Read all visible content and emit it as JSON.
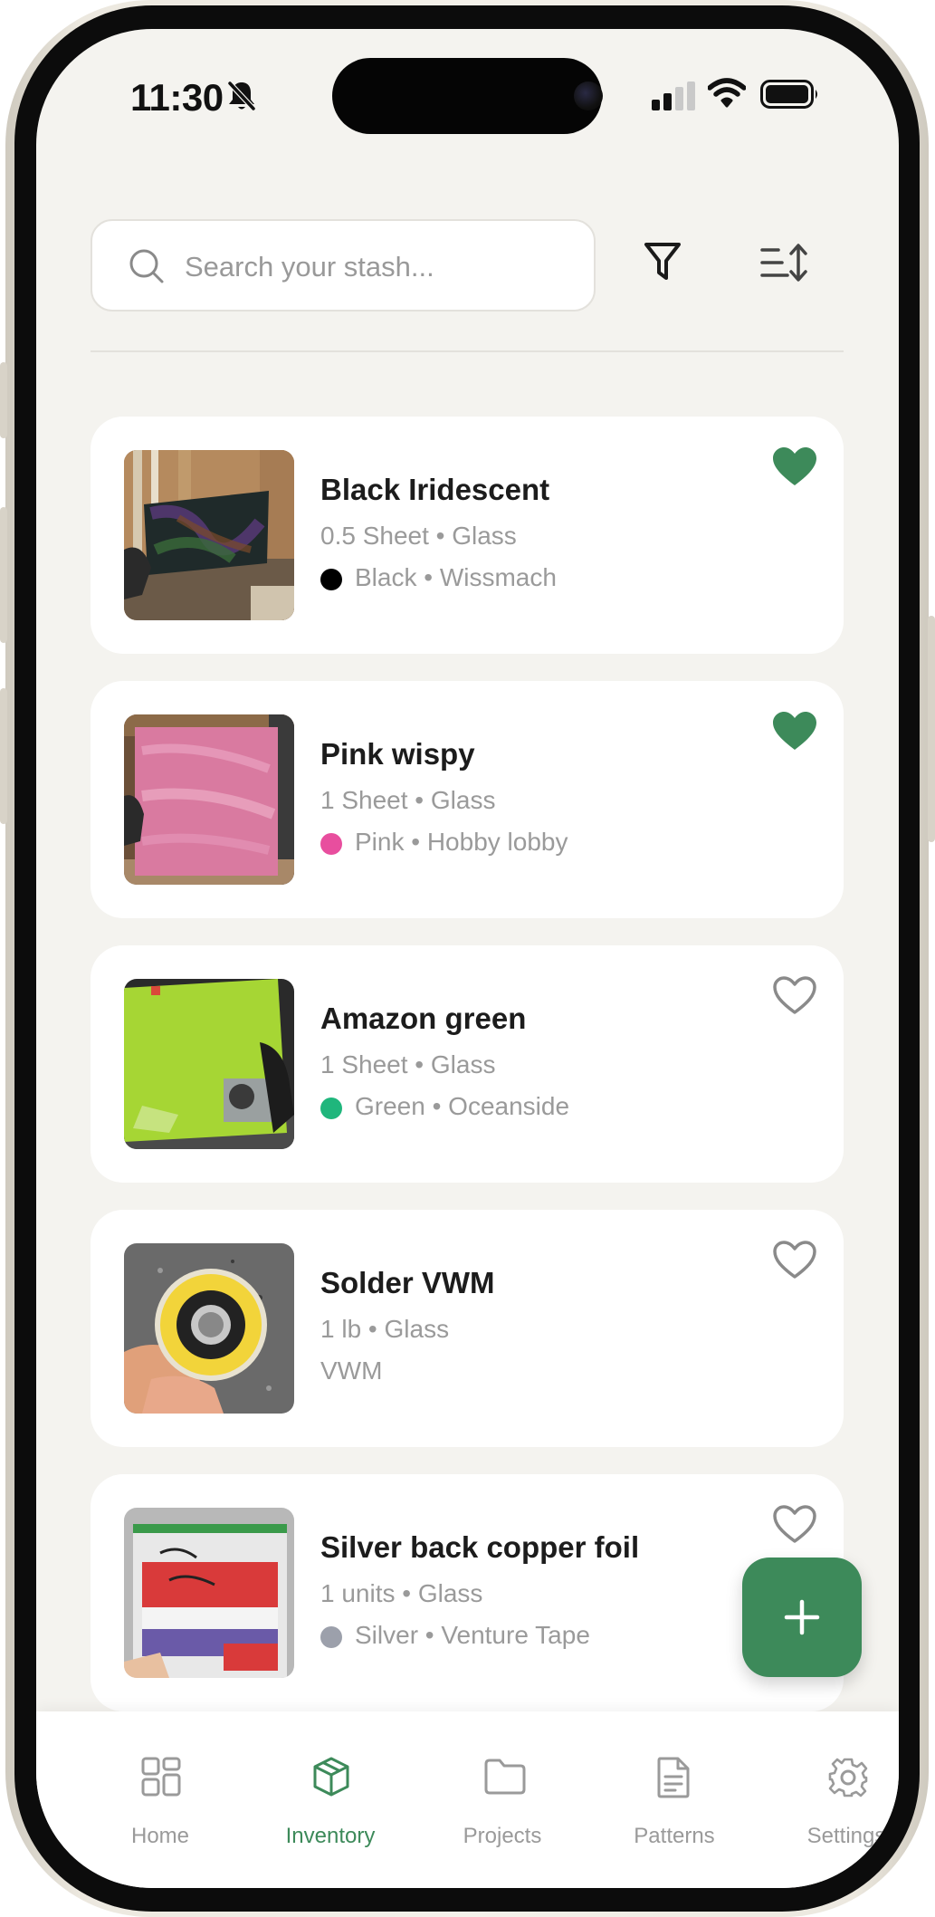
{
  "status_bar": {
    "time": "11:30"
  },
  "search": {
    "placeholder": "Search your stash..."
  },
  "items": [
    {
      "name": "Black Iridescent",
      "subtitle": "0.5 Sheet • Glass",
      "meta": "Black • Wissmach",
      "color_dot": "#000000",
      "favorite": true
    },
    {
      "name": "Pink wispy",
      "subtitle": "1 Sheet • Glass",
      "meta": "Pink • Hobby lobby",
      "color_dot": "#e84e9e",
      "favorite": true
    },
    {
      "name": "Amazon green",
      "subtitle": "1 Sheet • Glass",
      "meta": "Green • Oceanside",
      "color_dot": "#1fb67c",
      "favorite": false
    },
    {
      "name": "Solder VWM",
      "subtitle": "1 lb • Glass",
      "meta": "VWM",
      "color_dot": null,
      "favorite": false
    },
    {
      "name": "Silver back copper foil",
      "subtitle": "1 units • Glass",
      "meta": "Silver • Venture Tape",
      "color_dot": "#9ca0ab",
      "favorite": false
    }
  ],
  "tabs": [
    {
      "label": "Home",
      "icon": "grid-icon",
      "active": false
    },
    {
      "label": "Inventory",
      "icon": "box-icon",
      "active": true
    },
    {
      "label": "Projects",
      "icon": "folder-icon",
      "active": false
    },
    {
      "label": "Patterns",
      "icon": "document-icon",
      "active": false
    },
    {
      "label": "Settings",
      "icon": "gear-icon",
      "active": false
    }
  ],
  "colors": {
    "accent": "#3d8a5a",
    "background": "#f4f3ef",
    "muted_text": "#9a9a9a"
  }
}
